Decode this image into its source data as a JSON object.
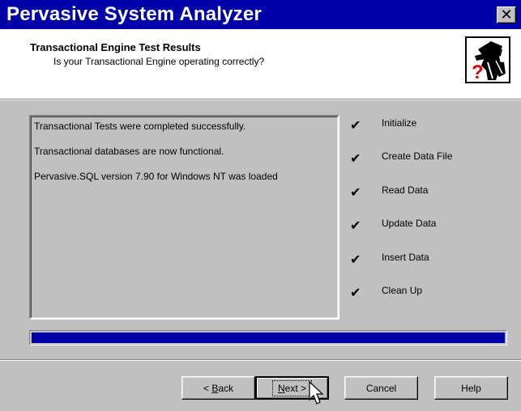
{
  "window": {
    "title": "Pervasive System Analyzer"
  },
  "header": {
    "title": "Transactional Engine Test Results",
    "subtitle": "Is your Transactional Engine operating correctly?",
    "icon": "detective-question-icon"
  },
  "results": {
    "lines": [
      "Transactional Tests were completed successfully.",
      "Transactional databases are now functional.",
      "Pervasive.SQL version 7.90 for Windows NT was loaded"
    ]
  },
  "steps": [
    {
      "check": "✔",
      "label": "Initialize"
    },
    {
      "check": "✔",
      "label": "Create Data File"
    },
    {
      "check": "✔",
      "label": "Read Data"
    },
    {
      "check": "✔",
      "label": "Update Data"
    },
    {
      "check": "✔",
      "label": "Insert Data"
    },
    {
      "check": "✔",
      "label": "Clean Up"
    }
  ],
  "progress": {
    "value": 1.0,
    "color": "#0000a8"
  },
  "buttons": {
    "back": {
      "prefix": "< ",
      "mnemonic": "B",
      "rest": "ack"
    },
    "next": {
      "mnemonic": "N",
      "rest": "ext >"
    },
    "cancel": "Cancel",
    "help": "Help"
  },
  "colors": {
    "titlebar": "#0000a8",
    "face": "#c0c0c0"
  }
}
